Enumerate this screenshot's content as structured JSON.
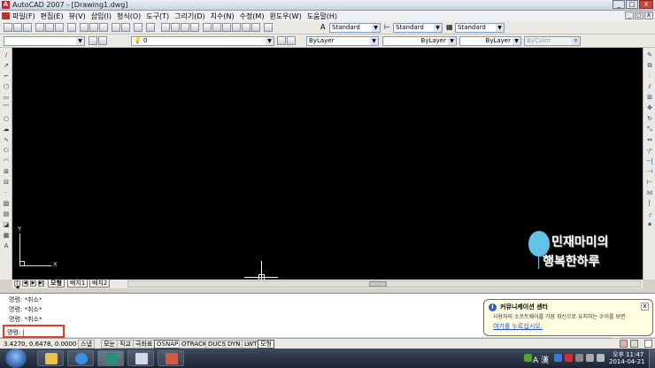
{
  "window": {
    "title": "AutoCAD 2007 - [Drawing1.dwg]",
    "app_icon": "autocad-logo-icon",
    "controls": [
      "_",
      "□",
      "X"
    ]
  },
  "menubar": {
    "items": [
      "파일(F)",
      "편집(E)",
      "뷰(V)",
      "삽입(I)",
      "형식(O)",
      "도구(T)",
      "그리기(D)",
      "치수(N)",
      "수정(M)",
      "윈도우(W)",
      "도움말(H)"
    ],
    "doc_controls": [
      "_",
      "□",
      "X"
    ]
  },
  "styles_toolbar": {
    "text_style": "Standard",
    "dim_style": "Standard",
    "table_style": "Standard"
  },
  "layers_toolbar": {
    "layer_value": "0",
    "color": "ByLayer",
    "linetype": "ByLayer",
    "lineweight": "ByLayer",
    "plotstyle": "ByColor"
  },
  "layout_tabs": {
    "tabs": [
      "모형",
      "배치1",
      "배치2"
    ],
    "active": "모형",
    "nav": [
      "|◀",
      "◀",
      "▶",
      "▶|"
    ]
  },
  "watermark": {
    "line1": "민재마미의",
    "line2": "행복한하루",
    "balloon_color": "#5fc4e6"
  },
  "command": {
    "history": [
      "명령: *취소*",
      "명령: *취소*",
      "명령: *취소*"
    ],
    "prompt": "명령:"
  },
  "statusbar": {
    "coords": "3.4270, 0.6478, 0.0000",
    "toggles": [
      {
        "label": "스냅",
        "on": false
      },
      {
        "label": "모눈",
        "on": false
      },
      {
        "label": "직교",
        "on": false
      },
      {
        "label": "극좌표",
        "on": false
      },
      {
        "label": "OSNAP",
        "on": true
      },
      {
        "label": "OTRACK",
        "on": false
      },
      {
        "label": "DUCS",
        "on": false
      },
      {
        "label": "DYN",
        "on": false
      },
      {
        "label": "LWT",
        "on": false
      },
      {
        "label": "모형",
        "on": true
      }
    ]
  },
  "notification": {
    "title": "커뮤니케이션 센터",
    "body": "사용자의 소프트웨어를 가장 최신으로 유지하는 수이를 보면",
    "link": "여기를 누르십시오.",
    "close": "x",
    "icon": "info-icon"
  },
  "taskbar": {
    "time": "오후 11:47",
    "date": "2014-04-21",
    "ime": "A 漢",
    "apps": [
      "folder-icon",
      "ie-icon",
      "autocad-taskbar-icon",
      "pen-app-icon",
      "paint-app-icon"
    ]
  },
  "colors": {
    "canvas": "#000000",
    "highlight_box": "#e13b2b",
    "taskbar": "#2a3447"
  }
}
